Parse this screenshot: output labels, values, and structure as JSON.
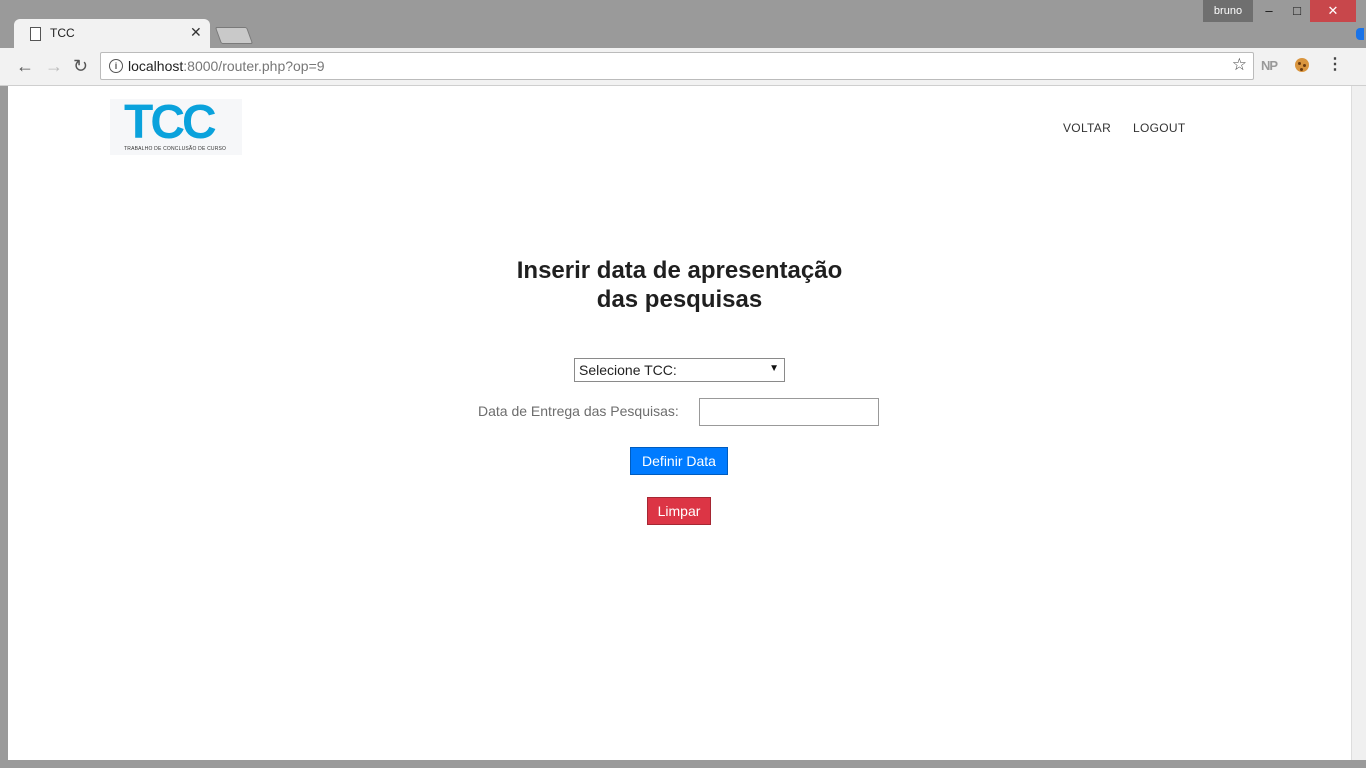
{
  "browser": {
    "user": "bruno",
    "tab_title": "TCC",
    "url_host": "localhost",
    "url_rest": ":8000/router.php?op=9",
    "ext_label": "NP"
  },
  "page": {
    "logo_text": "TCC",
    "logo_subtitle": "TRABALHO DE CONCLUSÃO DE CURSO",
    "nav": {
      "back": "VOLTAR",
      "logout": "LOGOUT"
    },
    "heading_line1": "Inserir data de apresentação",
    "heading_line2": "das pesquisas",
    "select_value": "Selecione TCC:",
    "date_label": "Data de Entrega das Pesquisas:",
    "date_value": "",
    "define_button": "Definir Data",
    "clear_button": "Limpar"
  },
  "colors": {
    "primary": "#007bff",
    "danger": "#dc3545",
    "logo": "#0aa2dc"
  }
}
